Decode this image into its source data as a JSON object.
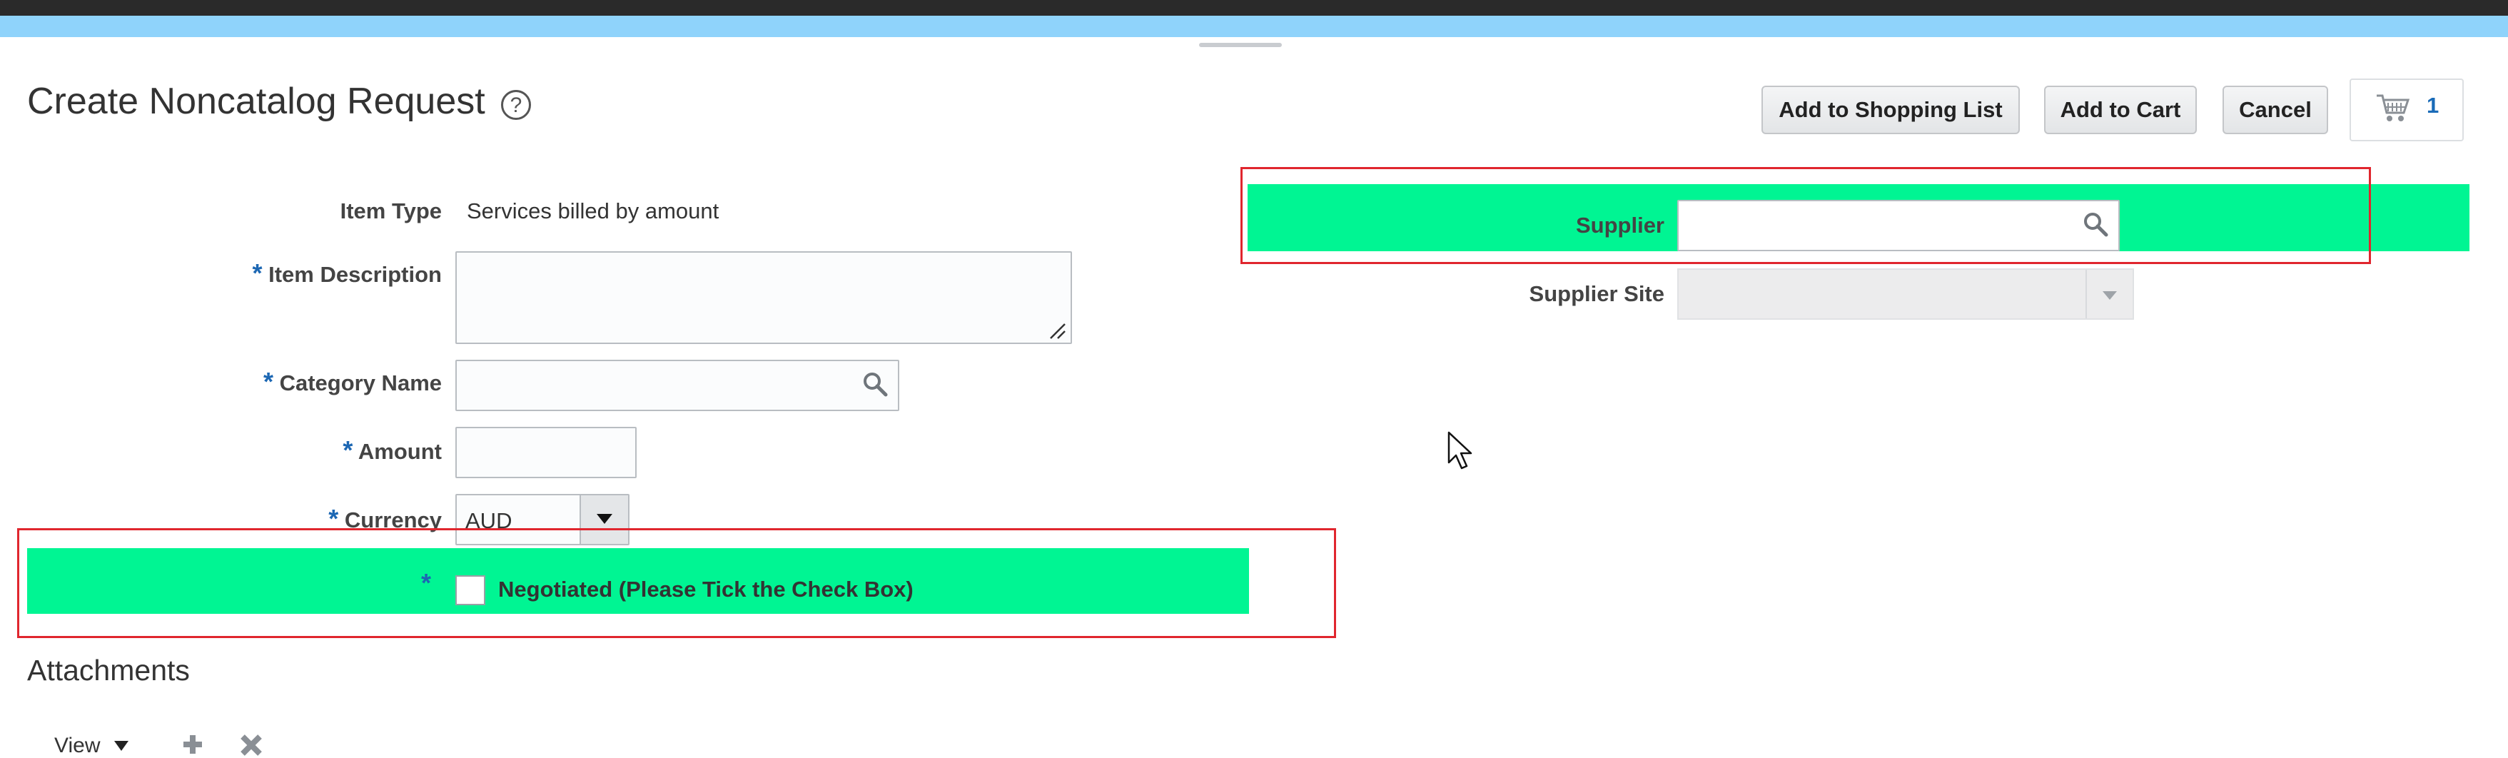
{
  "page": {
    "title": "Create Noncatalog Request",
    "help_icon": "question-circle-icon"
  },
  "toolbar": {
    "add_to_shopping_list": "Add to Shopping List",
    "add_to_cart": "Add to Cart",
    "cancel": "Cancel",
    "cart_icon": "shopping-cart-icon",
    "cart_count": "1"
  },
  "form": {
    "item_type": {
      "label": "Item Type",
      "value": "Services billed by amount"
    },
    "item_description": {
      "label": "Item Description",
      "required_marker": "*",
      "value": ""
    },
    "category_name": {
      "label": "Category Name",
      "required_marker": "*",
      "value": ""
    },
    "amount": {
      "label": "Amount",
      "required_marker": "*",
      "value": ""
    },
    "currency": {
      "label": "Currency",
      "required_marker": "*",
      "value": "AUD"
    },
    "negotiated": {
      "required_marker": "*",
      "label": "Negotiated (Please Tick the Check Box)",
      "checked": false
    },
    "supplier": {
      "label": "Supplier",
      "value": ""
    },
    "supplier_site": {
      "label": "Supplier Site",
      "value": ""
    }
  },
  "attachments": {
    "title": "Attachments",
    "view_label": "View",
    "add_icon": "plus-icon",
    "remove_icon": "x-icon"
  },
  "colors": {
    "highlight": "#00f593",
    "highlight_border": "#e0262e",
    "top_accent": "#8fd3fb",
    "required": "#1c67b3"
  }
}
